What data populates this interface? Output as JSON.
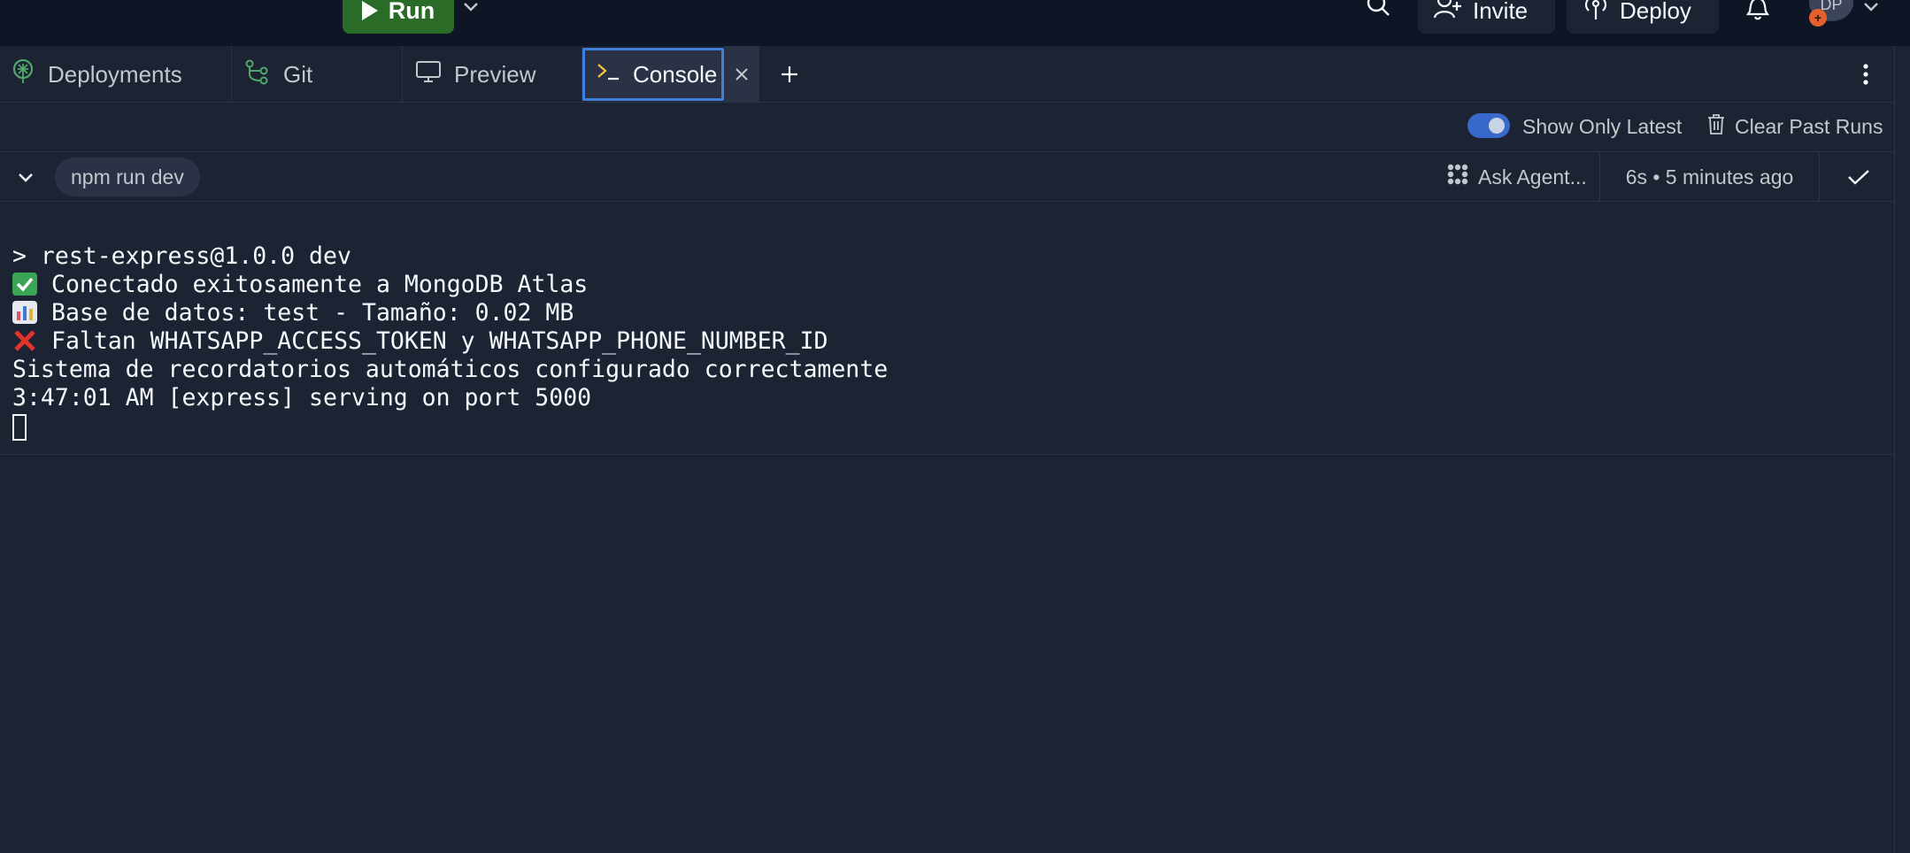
{
  "topbar": {
    "run_label": "Run",
    "invite_label": "Invite",
    "deploy_label": "Deploy",
    "avatar_initials": "DP"
  },
  "tabs": {
    "deployments": "Deployments",
    "git": "Git",
    "preview": "Preview",
    "console": "Console"
  },
  "options": {
    "show_only_latest_label": "Show Only Latest",
    "show_only_latest_on": true,
    "clear_label": "Clear Past Runs"
  },
  "run": {
    "command": "npm run dev",
    "ask_agent_label": "Ask Agent...",
    "time_label": "6s • 5 minutes ago"
  },
  "console_lines": {
    "l1": "> rest-express@1.0.0 dev",
    "l2": "Conectado exitosamente a MongoDB Atlas",
    "l3": "Base de datos: test - Tamaño: 0.02 MB",
    "l4": "Faltan WHATSAPP_ACCESS_TOKEN y WHATSAPP_PHONE_NUMBER_ID",
    "l5": "Sistema de recordatorios automáticos configurado correctamente",
    "l6": "3:47:01 AM [express] serving on port 5000"
  },
  "icons": {
    "run": "play-icon",
    "search": "search-icon",
    "invite": "add-user-icon",
    "deploy": "deploy-icon",
    "bell": "bell-icon",
    "deployments": "deployments-icon",
    "git": "git-icon",
    "preview": "monitor-icon",
    "console": "terminal-icon"
  },
  "colors": {
    "background": "#1c2333",
    "topbar": "#0e1525",
    "run_button": "#2b6b28",
    "accent_blue": "#3f7fe0",
    "text": "#f5f9fc",
    "muted_text": "#c2c8cc"
  }
}
